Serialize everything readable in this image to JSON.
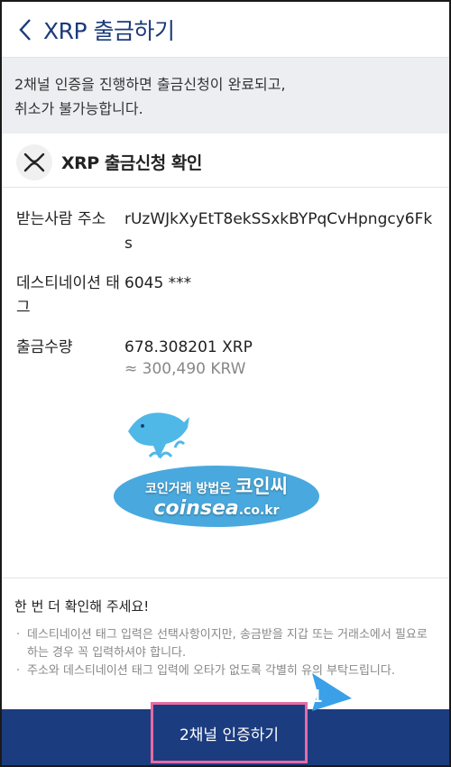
{
  "header": {
    "title": "XRP 출금하기"
  },
  "notice": {
    "line1": "2채널 인증을 진행하면 출금신청이 완료되고,",
    "line2": "취소가 불가능합니다."
  },
  "section": {
    "title": "XRP 출금신청 확인",
    "icon": "xrp-logo-icon"
  },
  "details": {
    "address_label": "받는사람 주소",
    "address_value": "rUzWJkXyEtT8ekSSxkBYPqCvHpngcy6Fks",
    "tag_label": "데스티네이션 태그",
    "tag_value": "6045 ***",
    "amount_label": "출금수량",
    "amount_value": "678.308201 XRP",
    "amount_krw": "≈ 300,490 KRW"
  },
  "watermark": {
    "line1_prefix": "코인거래 방법은",
    "line1_brand": "코인씨",
    "line2_main": "coinsea",
    "line2_suffix": ".co.kr"
  },
  "confirm": {
    "title": "한 번 더 확인해 주세요!",
    "notes": [
      "데스티네이션 태그 입력은 선택사항이지만, 송금받을 지갑 또는 거래소에서 필요로 하는 경우 꼭 입력하셔야 합니다.",
      "주소와 데스티네이션 태그 입력에 오타가 없도록 각별히 유의 부탁드립니다."
    ]
  },
  "button": {
    "label": "2채널 인증하기"
  },
  "annotation": {
    "step": "1"
  },
  "colors": {
    "brand_navy": "#1c3c80",
    "header_title": "#1b3a7a",
    "highlight_pink": "#e86aa3",
    "annotation_blue": "#3aa0e8"
  }
}
